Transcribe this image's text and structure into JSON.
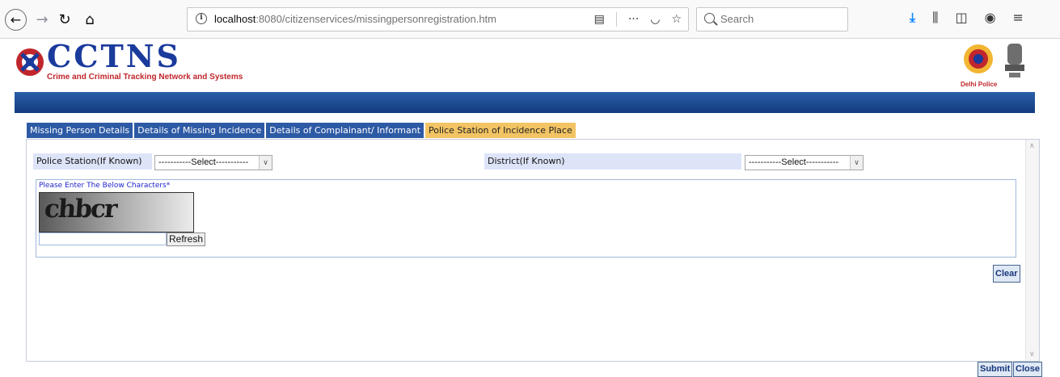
{
  "browser": {
    "url_host": "localhost",
    "url_path": ":8080/citizenservices/missingpersonregistration.htm",
    "search_placeholder": "Search"
  },
  "header": {
    "logo_title": "CCTNS",
    "logo_subtitle": "Crime and Criminal Tracking Network and Systems",
    "badge_text": "Delhi Police"
  },
  "tabs": [
    {
      "label": "Missing Person Details",
      "active": false
    },
    {
      "label": "Details of Missing Incidence",
      "active": false
    },
    {
      "label": "Details of Complainant/ Informant",
      "active": false
    },
    {
      "label": "Police Station of Incidence Place",
      "active": true
    }
  ],
  "form": {
    "police_station_label": "Police Station(If Known)",
    "police_station_value": "-----------Select-----------",
    "district_label": "District(If Known)",
    "district_value": "-----------Select-----------",
    "captcha_label": "Please Enter The Below Characters*",
    "captcha_text": "chbcr",
    "refresh_label": "Refresh",
    "clear_label": "Clear"
  },
  "footer": {
    "submit_label": "Submit",
    "close_label": "Close"
  }
}
